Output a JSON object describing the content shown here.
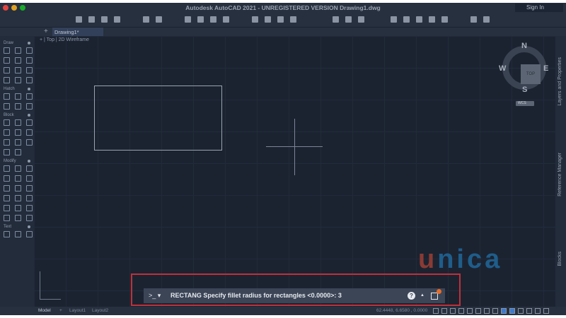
{
  "window": {
    "title": "Autodesk AutoCAD 2021 - UNREGISTERED VERSION  Drawing1.dwg",
    "sign_in": "Sign In"
  },
  "tabs": {
    "document": "Drawing1*"
  },
  "viewport": {
    "label": "+ | Top | 2D Wireframe"
  },
  "palette": {
    "sections": [
      {
        "title": "Draw",
        "icons": [
          "line-icon",
          "polyline-icon",
          "circle-icon",
          "rectangle-icon",
          "arc-icon",
          "spline-icon",
          "multiline-icon",
          "ray-icon",
          "ellipse-icon",
          "rectangle-options-icon",
          "xline-icon",
          "revcloud-icon"
        ]
      },
      {
        "title": "Hatch",
        "icons": [
          "hatch-icon",
          "gradient-icon",
          "boundary-icon",
          "region-icon",
          "image-icon",
          "wipeout-icon"
        ]
      },
      {
        "title": "Block",
        "icons": [
          "insert-block-icon",
          "create-block-icon",
          "edit-block-icon",
          "attribute-icon",
          "define-attribute-icon",
          "block-editor-icon",
          "wblock-icon",
          "base-icon",
          "attribute-edit-icon",
          "block-manager-icon",
          "attribute-sync-icon"
        ]
      },
      {
        "title": "Modify",
        "icons": [
          "move-icon",
          "copy-icon",
          "stretch-icon",
          "rotate-icon",
          "mirror-icon",
          "trim-icon",
          "fillet-icon",
          "offset-icon",
          "array-icon",
          "erase-icon",
          "explode-icon",
          "join-icon",
          "scale-icon",
          "break-icon",
          "lengthen-icon",
          "match-icon",
          "align-icon",
          "paint-icon"
        ]
      },
      {
        "title": "Text",
        "icons": [
          "text-icon",
          "mtext-icon",
          "text-style-icon"
        ]
      }
    ]
  },
  "viewcube": {
    "n": "N",
    "s": "S",
    "e": "E",
    "w": "W",
    "top": "TOP",
    "wcs": "WCS"
  },
  "right_panels": [
    "Layers and Properties",
    "Reference Manager",
    "Blocks"
  ],
  "watermark": {
    "part1": "u",
    "part2": "nica"
  },
  "layout_tabs": [
    "Model",
    "Layout1",
    "Layout2"
  ],
  "status": {
    "coords": "62.4448, 6.6580 , 0.0000"
  },
  "command": {
    "prompt": ">_ ▾",
    "text": "RECTANG Specify fillet radius for rectangles <0.0000>: 3",
    "help": "?"
  },
  "colors": {
    "accent_frame": "#c0303a",
    "badge": "#e76b2b"
  }
}
